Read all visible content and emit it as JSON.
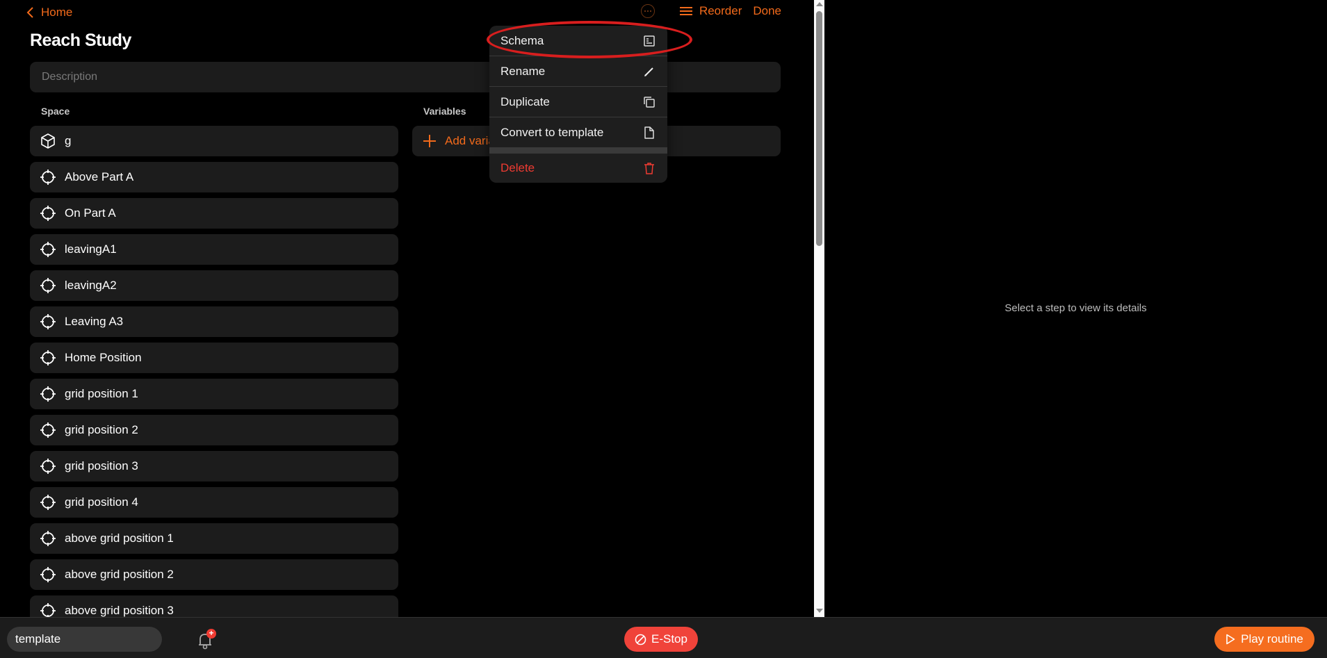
{
  "header": {
    "back_label": "Home",
    "title": "Reach Study",
    "description_placeholder": "Description",
    "description_value": "",
    "reorder_label": "Reorder",
    "done_label": "Done"
  },
  "space": {
    "label": "Space",
    "items": [
      {
        "label": "g",
        "icon": "cube-icon"
      },
      {
        "label": "Above Part A",
        "icon": "crosshair-icon"
      },
      {
        "label": "On Part A",
        "icon": "crosshair-icon"
      },
      {
        "label": "leavingA1",
        "icon": "crosshair-icon"
      },
      {
        "label": "leavingA2",
        "icon": "crosshair-icon"
      },
      {
        "label": "Leaving A3",
        "icon": "crosshair-icon"
      },
      {
        "label": "Home Position",
        "icon": "crosshair-icon"
      },
      {
        "label": "grid position 1",
        "icon": "crosshair-icon"
      },
      {
        "label": "grid position 2",
        "icon": "crosshair-icon"
      },
      {
        "label": "grid position 3",
        "icon": "crosshair-icon"
      },
      {
        "label": "grid position 4",
        "icon": "crosshair-icon"
      },
      {
        "label": "above grid position 1",
        "icon": "crosshair-icon"
      },
      {
        "label": "above grid position 2",
        "icon": "crosshair-icon"
      },
      {
        "label": "above grid position 3",
        "icon": "crosshair-icon"
      }
    ]
  },
  "variables": {
    "label": "Variables",
    "add_label": "Add variable"
  },
  "menu": {
    "items": [
      {
        "label": "Schema",
        "icon": "schema-icon"
      },
      {
        "label": "Rename",
        "icon": "pencil-icon"
      },
      {
        "label": "Duplicate",
        "icon": "copy-icon"
      },
      {
        "label": "Convert to template",
        "icon": "file-icon"
      }
    ],
    "delete_label": "Delete"
  },
  "details": {
    "hint": "Select a step to view its details"
  },
  "bottom": {
    "template_value": "template",
    "notification_badge": "+",
    "estop_label": "E-Stop",
    "play_label": "Play routine"
  },
  "colors": {
    "accent": "#f26a1b",
    "danger": "#ef3b32",
    "highlight": "#d81e1e"
  }
}
